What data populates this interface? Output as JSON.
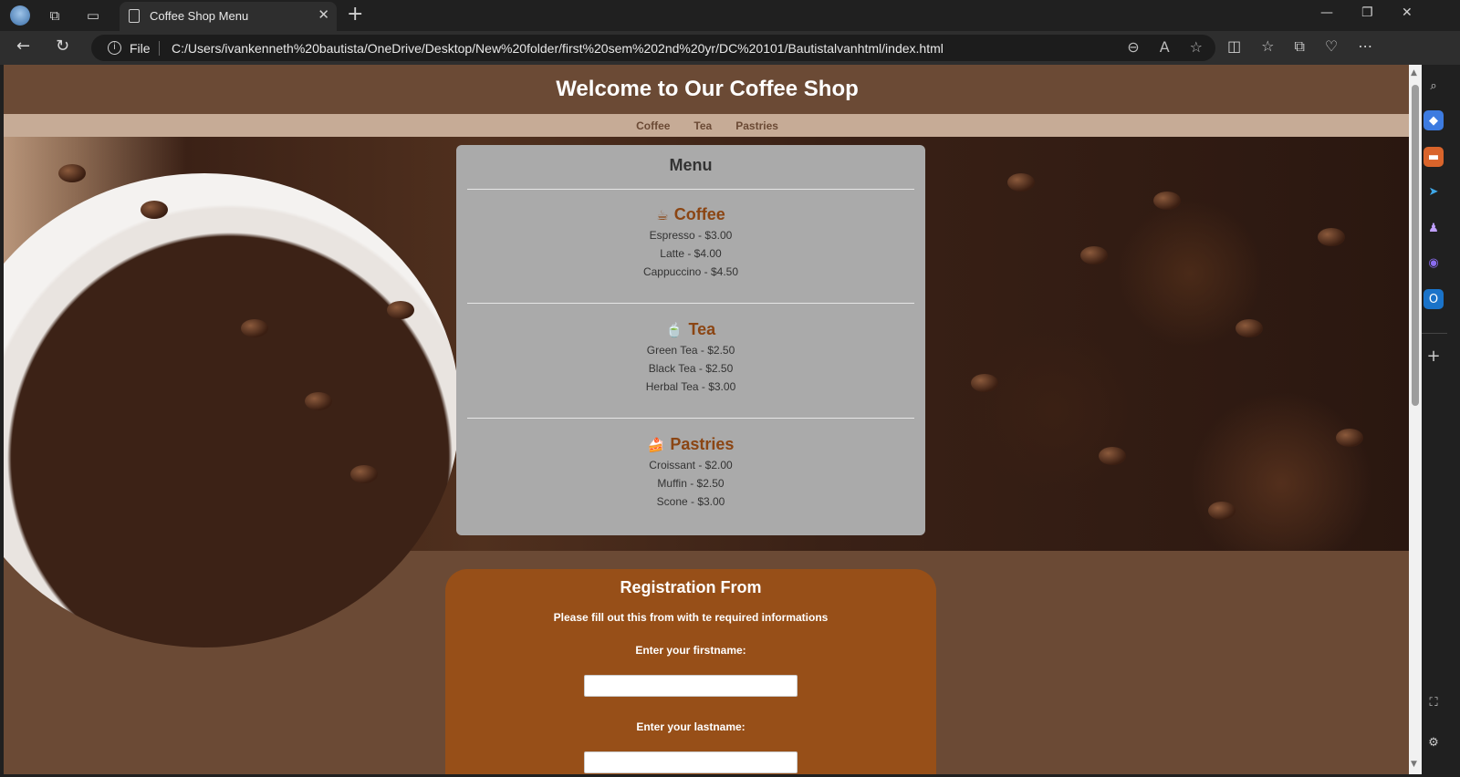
{
  "browser": {
    "tab_title": "Coffee Shop Menu",
    "address_file_label": "File",
    "address_url": "C:/Users/ivankenneth%20bautista/OneDrive/Desktop/New%20folder/first%20sem%202nd%20yr/DC%20101/Bautistalvanhtml/index.html"
  },
  "site": {
    "title": "Welcome to Our Coffee Shop",
    "nav": [
      "Coffee",
      "Tea",
      "Pastries"
    ]
  },
  "menu": {
    "title": "Menu",
    "sections": [
      {
        "emoji": "☕",
        "title": "Coffee",
        "items": [
          "Espresso - $3.00",
          "Latte - $4.00",
          "Cappuccino - $4.50"
        ]
      },
      {
        "emoji": "🍵",
        "title": "Tea",
        "items": [
          "Green Tea - $2.50",
          "Black Tea - $2.50",
          "Herbal Tea - $3.00"
        ]
      },
      {
        "emoji": "🍰",
        "title": "Pastries",
        "items": [
          "Croissant - $2.00",
          "Muffin - $2.50",
          "Scone - $3.00"
        ]
      }
    ]
  },
  "registration": {
    "title": "Registration From",
    "subtitle": "Please fill out this from with te required informations",
    "firstname_label": "Enter your firstname:",
    "lastname_label": "Enter your lastname:"
  },
  "colors": {
    "header_bg": "#6b4a35",
    "nav_bg": "#c6ab96",
    "menu_card_bg": "#aaaaaa",
    "section_title": "#8b4513",
    "registration_bg": "#974f18"
  }
}
